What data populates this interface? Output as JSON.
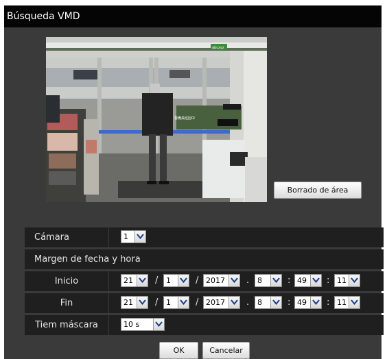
{
  "window": {
    "title": "Búsqueda VMD"
  },
  "image": {
    "sign_text": "abcxyz",
    "poster_text": "警備員巡回中"
  },
  "area_clear_button": "Borrado de área",
  "camera": {
    "label": "Cámara",
    "value": "1"
  },
  "range": {
    "label": "Margen de fecha y hora"
  },
  "start": {
    "label": "Inicio",
    "day": "21",
    "month": "1",
    "year": "2017",
    "hour": "8",
    "minute": "49",
    "second": "11"
  },
  "end": {
    "label": "Fin",
    "day": "21",
    "month": "1",
    "year": "2017",
    "hour": "8",
    "minute": "49",
    "second": "11"
  },
  "separators": {
    "date": "/",
    "datetime": ".",
    "time": ":"
  },
  "mask_time": {
    "label": "Tiem máscara",
    "value": "10 s"
  },
  "buttons": {
    "ok": "OK",
    "cancel": "Cancelar"
  }
}
